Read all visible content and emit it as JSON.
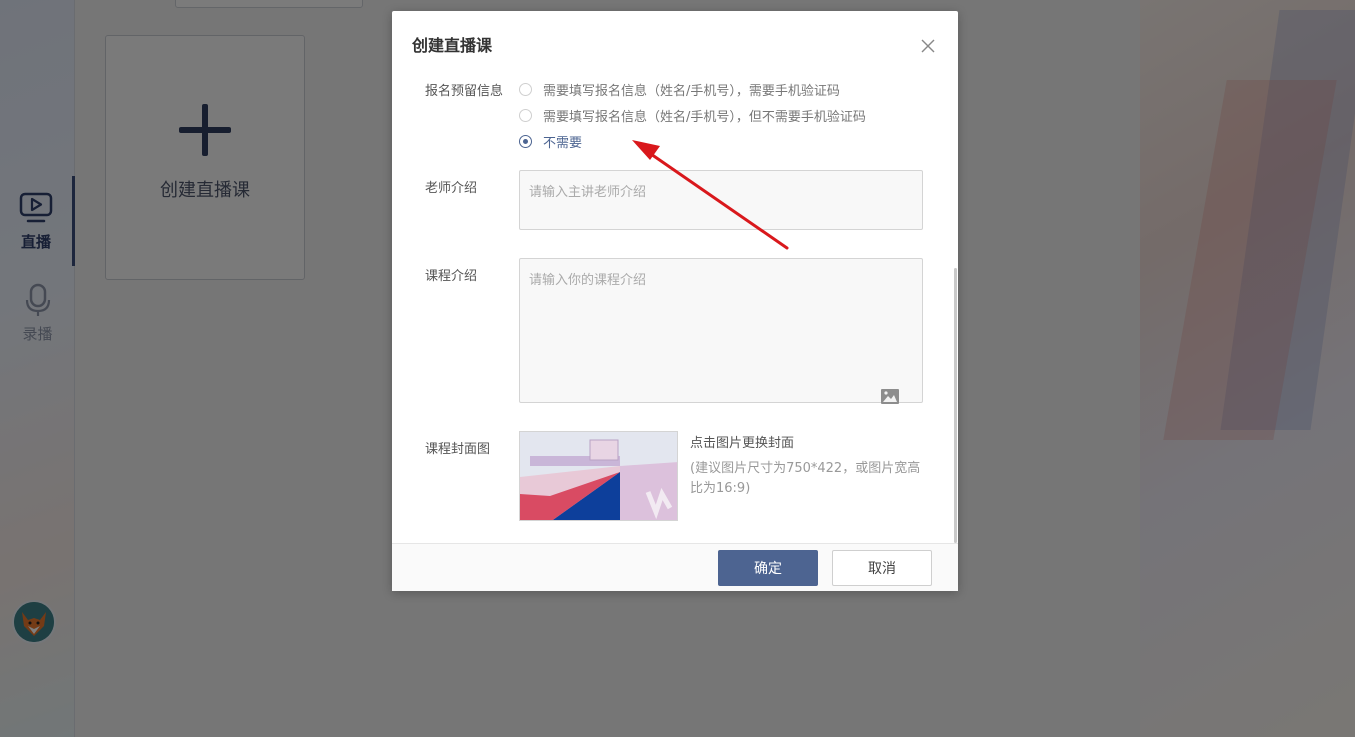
{
  "sidebar": {
    "items": [
      {
        "label": "直播",
        "icon": "live-video-icon",
        "active": true
      },
      {
        "label": "录播",
        "icon": "microphone-icon",
        "active": false
      }
    ],
    "avatar": "fox-avatar"
  },
  "main": {
    "create_card_label": "创建直播课",
    "create_card_icon": "plus-icon"
  },
  "modal": {
    "title": "创建直播课",
    "close_icon": "close-icon",
    "registration": {
      "label": "报名预留信息",
      "options": [
        {
          "label": "需要填写报名信息（姓名/手机号），需要手机验证码",
          "selected": false
        },
        {
          "label": "需要填写报名信息（姓名/手机号），但不需要手机验证码",
          "selected": false
        },
        {
          "label": "不需要",
          "selected": true
        }
      ]
    },
    "teacher_intro": {
      "label": "老师介绍",
      "placeholder": "请输入主讲老师介绍",
      "value": ""
    },
    "course_intro": {
      "label": "课程介绍",
      "placeholder": "请输入你的课程介绍",
      "value": "",
      "image_icon": "image-icon"
    },
    "cover": {
      "label": "课程封面图",
      "change_text": "点击图片更换封面",
      "hint": "(建议图片尺寸为750*422，或图片宽高比为16:9)"
    },
    "footer": {
      "ok_label": "确定",
      "cancel_label": "取消"
    }
  },
  "colors": {
    "accent": "#4d6491",
    "overlay": "rgba(0,0,0,0.5)",
    "annotation_arrow": "#d9181c"
  }
}
